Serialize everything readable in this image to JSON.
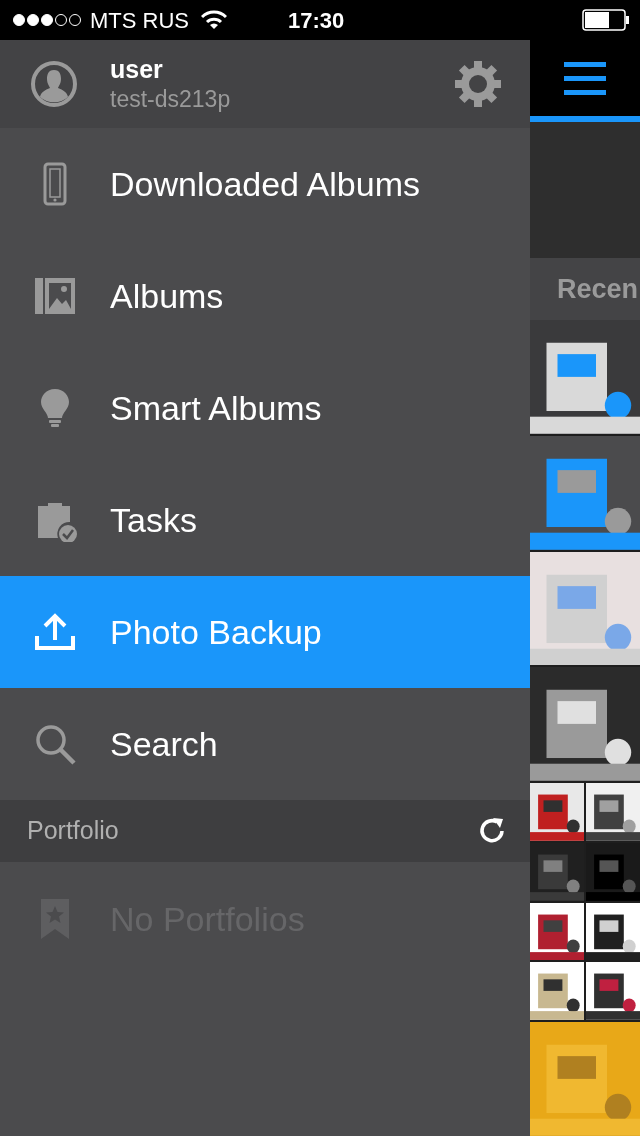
{
  "status_bar": {
    "carrier": "MTS RUS",
    "time": "17:30"
  },
  "account": {
    "name": "user",
    "server": "test-ds213p"
  },
  "menu": [
    {
      "label": "Downloaded Albums",
      "selected": false
    },
    {
      "label": "Albums",
      "selected": false
    },
    {
      "label": "Smart Albums",
      "selected": false
    },
    {
      "label": "Tasks",
      "selected": false
    },
    {
      "label": "Photo Backup",
      "selected": true
    },
    {
      "label": "Search",
      "selected": false
    }
  ],
  "section": {
    "title": "Portfolio"
  },
  "portfolio": {
    "label": "No Portfolios",
    "disabled": true
  },
  "main": {
    "header": "Recen"
  }
}
